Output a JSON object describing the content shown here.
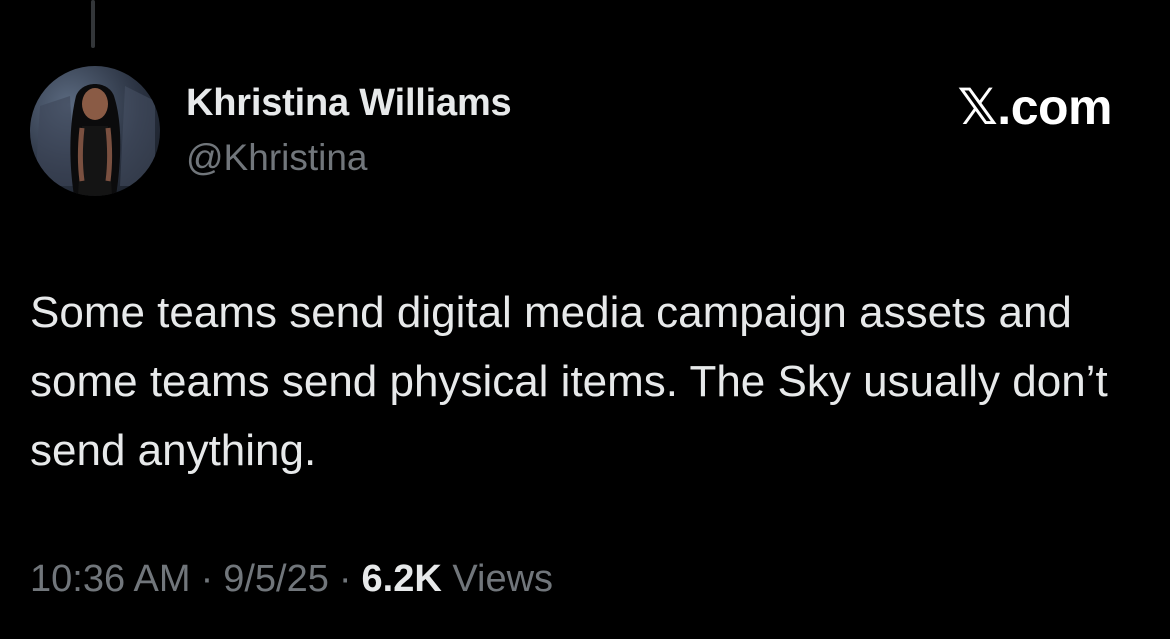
{
  "tweet": {
    "author": {
      "display_name": "Khristina Williams",
      "handle": "@Khristina"
    },
    "brand": "𝕏.com",
    "text": "Some teams send digital media campaign assets and some teams send physical items. The Sky usually don’t send anything.",
    "meta": {
      "time": "10:36 AM",
      "separator": "·",
      "date": "9/5/25",
      "views_count": "6.2K",
      "views_label": "Views"
    }
  },
  "colors": {
    "background": "#000000",
    "primary_text": "#e7e9ea",
    "secondary_text": "#71767b"
  }
}
